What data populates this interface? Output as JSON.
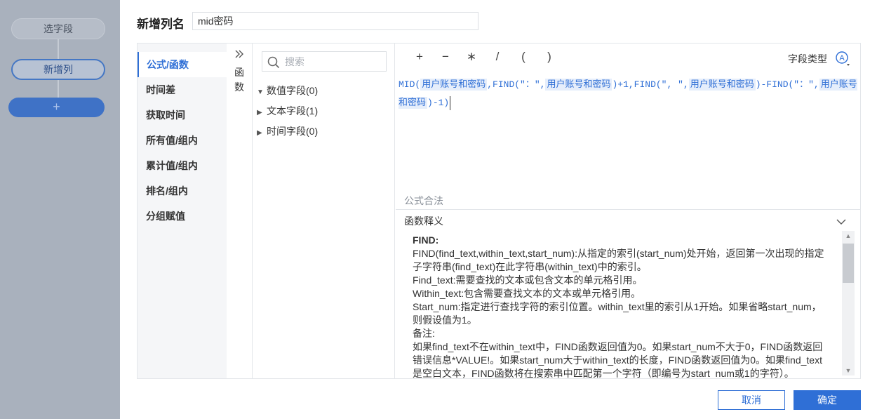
{
  "flow": {
    "nodes": [
      "选字段",
      "新增列"
    ],
    "add_label": "+"
  },
  "header": {
    "label": "新增列名",
    "column_name": "mid密码"
  },
  "categories": [
    "公式/函数",
    "时间差",
    "获取时间",
    "所有值/组内",
    "累计值/组内",
    "排名/组内",
    "分组赋值"
  ],
  "collapse": {
    "icon": "double-chevron-right-icon",
    "text": "函数"
  },
  "fields": {
    "search_placeholder": "搜索",
    "tree": [
      "数值字段(0)",
      "文本字段(1)",
      "时间字段(0)"
    ]
  },
  "toolbar": {
    "operators": [
      "+",
      "−",
      "∗",
      "/",
      "(",
      ")"
    ],
    "type_label": "字段类型",
    "type_icon": "text-type-icon"
  },
  "formula": {
    "parts": [
      {
        "t": "fn",
        "v": "MID("
      },
      {
        "t": "field",
        "v": "用户账号和密码"
      },
      {
        "t": "fn",
        "v": ",FIND(\"："
      },
      {
        "t": "fn",
        "v": "\","
      },
      {
        "t": "field",
        "v": "用户账号和密码"
      },
      {
        "t": "fn",
        "v": ")+1,FIND(\", \","
      },
      {
        "t": "field",
        "v": "用户账号和密码"
      },
      {
        "t": "fn",
        "v": ")-FIND(\"：\","
      },
      {
        "t": "field",
        "v": "用户账号和密码"
      },
      {
        "t": "fn",
        "v": ")-1)"
      }
    ],
    "status": "公式合法"
  },
  "explain": {
    "title": "函数释义",
    "lines": [
      "FIND:",
      "FIND(find_text,within_text,start_num):从指定的索引(start_num)处开始，返回第一次出现的指定子字符串(find_text)在此字符串(within_text)中的索引。",
      "Find_text:需要查找的文本或包含文本的单元格引用。",
      "Within_text:包含需要查找文本的文本或单元格引用。",
      "Start_num:指定进行查找字符的索引位置。within_text里的索引从1开始。如果省略start_num，则假设值为1。",
      "备注:",
      "如果find_text不在within_text中，FIND函数返回值为0。如果start_num不大于0，FIND函数返回错误信息*VALUE!。如果start_num大于within_text的长度，FIND函数返回值为0。如果find_text是空白文本，FIND函数将在搜索串中匹配第一个字符（即编号为start_num或1的字符）。"
    ]
  },
  "buttons": {
    "cancel": "取消",
    "ok": "确定"
  },
  "colors": {
    "accent": "#2f6fd6",
    "sidebar_bg": "#a9b1bd"
  }
}
